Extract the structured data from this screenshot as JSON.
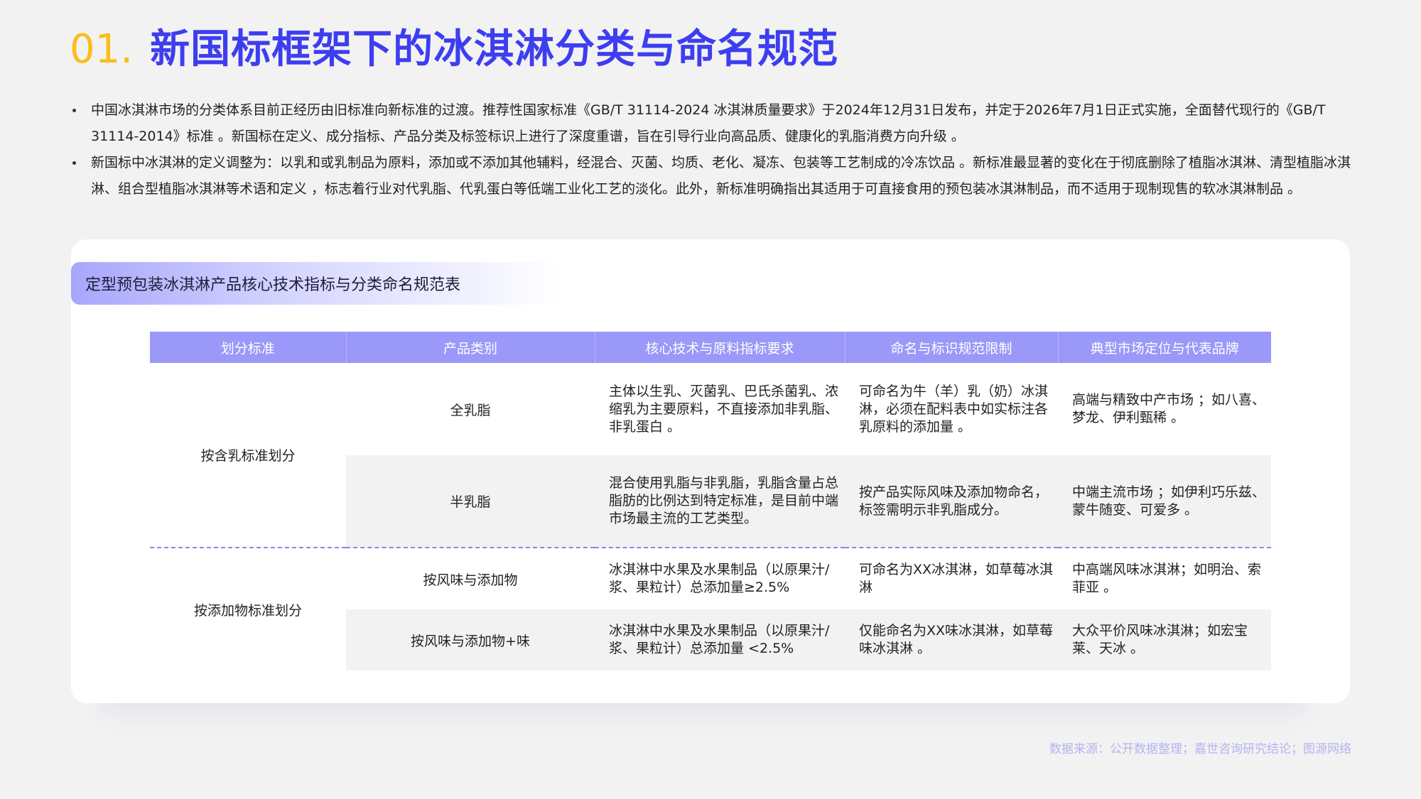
{
  "header": {
    "number": "01.",
    "title": "新国标框架下的冰淇淋分类与命名规范"
  },
  "bullets": [
    "中国冰淇淋市场的分类体系目前正经历由旧标准向新标准的过渡。推荐性国家标准《GB/T 31114-2024 冰淇淋质量要求》于2024年12月31日发布，并定于2026年7月1日正式实施，全面替代现行的《GB/T 31114-2014》标准 。新国标在定义、成分指标、产品分类及标签标识上进行了深度重谱，旨在引导行业向高品质、健康化的乳脂消费方向升级 。",
    "新国标中冰淇淋的定义调整为：以乳和或乳制品为原料，添加或不添加其他辅料，经混合、灭菌、均质、老化、凝冻、包装等工艺制成的冷冻饮品 。新标准最显著的变化在于彻底删除了植脂冰淇淋、清型植脂冰淇淋、组合型植脂冰淇淋等术语和定义 ，标志着行业对代乳脂、代乳蛋白等低端工业化工艺的淡化。此外，新标准明确指出其适用于可直接食用的预包装冰淇淋制品，而不适用于现制现售的软冰淇淋制品 。"
  ],
  "table": {
    "title": "定型预包装冰淇淋产品核心技术指标与分类命名规范表",
    "headers": [
      "划分标准",
      "产品类别",
      "核心技术与原料指标要求",
      "命名与标识规范限制",
      "典型市场定位与代表品牌"
    ],
    "groups": [
      {
        "name": "按含乳标准划分",
        "rows": [
          {
            "category": "全乳脂",
            "requirement": "主体以生乳、灭菌乳、巴氏杀菌乳、浓缩乳为主要原料，不直接添加非乳脂、非乳蛋白 。",
            "naming": "可命名为牛（羊）乳（奶）冰淇淋，必须在配料表中如实标注各乳原料的添加量 。",
            "market": "高端与精致中产市场 ；如八喜、梦龙、伊利甄稀 。"
          },
          {
            "category": "半乳脂",
            "requirement": "混合使用乳脂与非乳脂，乳脂含量占总脂肪的比例达到特定标准，是目前中端市场最主流的工艺类型。",
            "naming": "按产品实际风味及添加物命名，标签需明示非乳脂成分。",
            "market": "中端主流市场 ；如伊利巧乐兹、蒙牛随变、可爱多 。"
          }
        ]
      },
      {
        "name": "按添加物标准划分",
        "rows": [
          {
            "category": "按风味与添加物",
            "requirement": "冰淇淋中水果及水果制品（以原果汁/浆、果粒计）总添加量≥2.5%",
            "naming": "可命名为XX冰淇淋，如草莓冰淇淋",
            "market": "中高端风味冰淇淋；如明治、索菲亚 。"
          },
          {
            "category": "按风味与添加物+味",
            "requirement": "冰淇淋中水果及水果制品（以原果汁/浆、果粒计）总添加量 <2.5%",
            "naming": "仅能命名为XX味冰淇淋，如草莓味冰淇淋 。",
            "market": "大众平价风味冰淇淋；如宏宝莱、天冰 。"
          }
        ]
      }
    ]
  },
  "source": "数据来源：公开数据整理；嘉世咨询研究结论；图源网络"
}
